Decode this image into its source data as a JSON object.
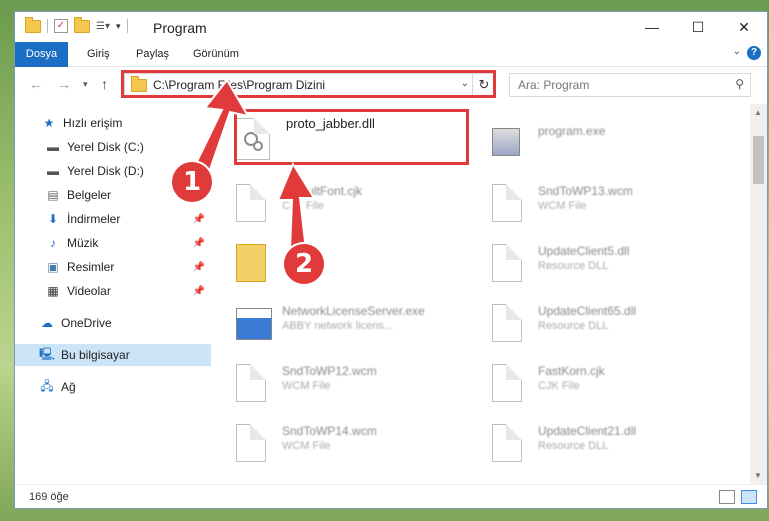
{
  "window": {
    "title": "Program"
  },
  "window_buttons": {
    "minimize": "—",
    "maximize": "☐",
    "close": "✕"
  },
  "ribbon": {
    "tabs": [
      {
        "label": "Dosya"
      },
      {
        "label": "Giriş"
      },
      {
        "label": "Paylaş"
      },
      {
        "label": "Görünüm"
      }
    ]
  },
  "address": {
    "path": "C:\\Program Files\\Program Dizini"
  },
  "search": {
    "placeholder": "Ara: Program"
  },
  "sidebar": {
    "items": [
      {
        "label": "Hızlı erişim",
        "icon": "star-icon"
      },
      {
        "label": "Yerel Disk (C:)",
        "icon": "drive-icon"
      },
      {
        "label": "Yerel Disk (D:)",
        "icon": "drive-icon"
      },
      {
        "label": "Belgeler",
        "icon": "documents-icon"
      },
      {
        "label": "İndirmeler",
        "icon": "download-icon",
        "pinned": true
      },
      {
        "label": "Müzik",
        "icon": "music-icon",
        "pinned": true
      },
      {
        "label": "Resimler",
        "icon": "pictures-icon",
        "pinned": true
      },
      {
        "label": "Videolar",
        "icon": "videos-icon",
        "pinned": true
      },
      {
        "label": "OneDrive",
        "icon": "cloud-icon"
      },
      {
        "label": "Bu bilgisayar",
        "icon": "computer-icon",
        "selected": true
      },
      {
        "label": "Ağ",
        "icon": "network-icon"
      }
    ]
  },
  "files": {
    "left": [
      {
        "name": "proto_jabber.dll",
        "type": ""
      },
      {
        "name": "DefaultFont.cjk",
        "type": "CJK File"
      },
      {
        "name": "",
        "type": ""
      },
      {
        "name": "NetworkLicenseServer.exe",
        "type": "ABBY network licens..."
      },
      {
        "name": "SndToWP12.wcm",
        "type": "WCM File"
      },
      {
        "name": "SndToWP14.wcm",
        "type": "WCM File"
      }
    ],
    "right": [
      {
        "name": "program.exe",
        "type": ""
      },
      {
        "name": "SndToWP13.wcm",
        "type": "WCM File"
      },
      {
        "name": "UpdateClient5.dll",
        "type": "Resource DLL"
      },
      {
        "name": "UpdateClient65.dll",
        "type": "Resource DLL"
      },
      {
        "name": "FastKorn.cjk",
        "type": "CJK File"
      },
      {
        "name": "UpdateClient21.dll",
        "type": "Resource DLL"
      }
    ]
  },
  "status": {
    "count": "169 öğe"
  },
  "callouts": {
    "one": "1",
    "two": "2"
  },
  "colors": {
    "accent": "#1a6fc5",
    "highlight": "#e03a3a",
    "selected": "#cce4f7"
  }
}
